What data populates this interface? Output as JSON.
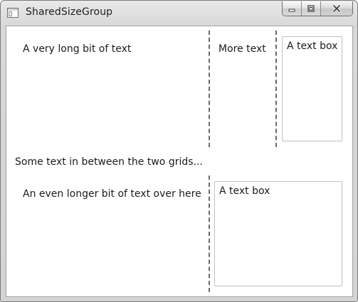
{
  "window": {
    "title": "SharedSizeGroup"
  },
  "icons": {
    "app": "application-icon",
    "minimize": "minimize-icon",
    "maximize": "maximize-icon",
    "close": "close-icon"
  },
  "grid1": {
    "cell1_text": "A very long bit of text",
    "cell2_text": "More text",
    "textbox_value": "A text box"
  },
  "between_text": "Some text in between the two grids...",
  "grid2": {
    "cell1_text": "An even longer bit of text over here",
    "textbox_value": "A text box"
  },
  "colors": {
    "splitter": "#6a6a6a",
    "textbox_border": "#b9c3cc"
  }
}
